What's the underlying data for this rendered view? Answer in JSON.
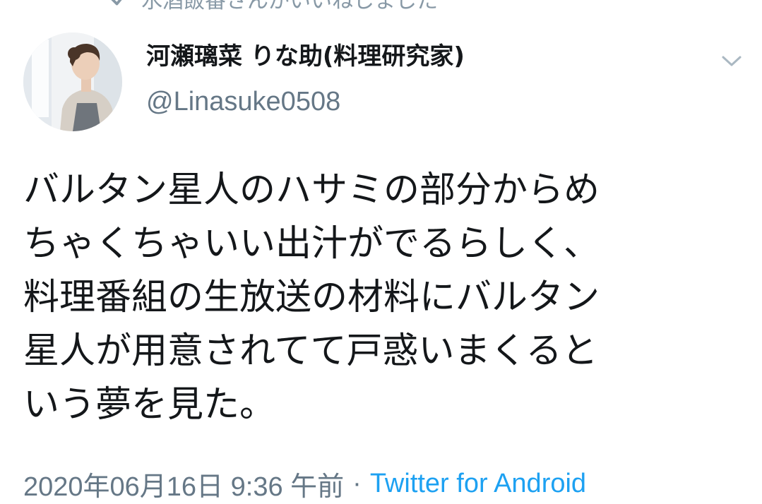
{
  "social_context": {
    "icon": "check-icon",
    "text": "水酒飯番さんがいいねしました"
  },
  "tweet": {
    "author": {
      "display_name": "河瀬璃菜 りな助(料理研究家)",
      "handle": "@Linasuke0508"
    },
    "text_lines": [
      "バルタン星人のハサミの部分からめ",
      "ちゃくちゃいい出汁がでるらしく、",
      "料理番組の生放送の材料にバルタン",
      "星人が用意されてて戸惑いまくると",
      "いう夢を見た。"
    ],
    "timestamp": "2020年06月16日 9:36 午前",
    "separator": "·",
    "source": "Twitter for Android"
  },
  "colors": {
    "text_primary": "#14171a",
    "text_secondary": "#657786",
    "link": "#1da1f2",
    "icon_gray": "#aab8c2"
  }
}
